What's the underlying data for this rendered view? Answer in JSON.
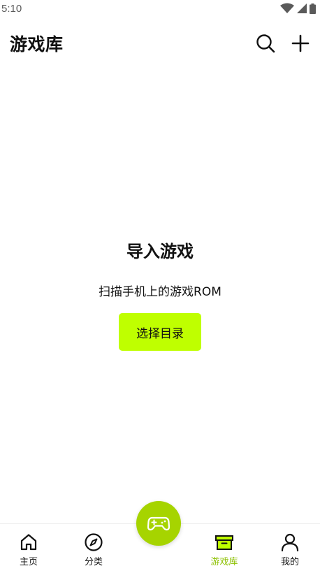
{
  "status_bar": {
    "time": "5:10"
  },
  "header": {
    "title": "游戏库"
  },
  "empty_state": {
    "title": "导入游戏",
    "subtitle": "扫描手机上的游戏ROM",
    "button_label": "选择目录"
  },
  "bottom_nav": {
    "items": [
      {
        "label": "主页",
        "icon": "home-icon"
      },
      {
        "label": "分类",
        "icon": "compass-icon"
      },
      {
        "label": "游戏库",
        "icon": "archive-box-icon",
        "active": true
      },
      {
        "label": "我的",
        "icon": "person-icon"
      }
    ]
  },
  "colors": {
    "accent": "#bfff00",
    "fab": "#a6d400",
    "active_label": "#8cc000"
  }
}
